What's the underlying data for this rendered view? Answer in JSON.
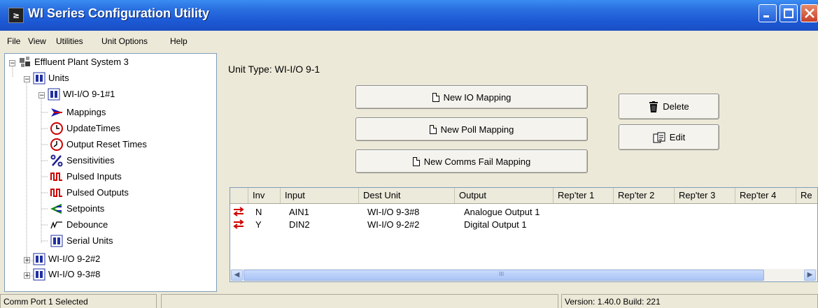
{
  "window": {
    "title": "WI Series Configuration Utility",
    "app_icon": "app-logo-icon"
  },
  "menu": [
    "File",
    "View",
    "Utilities",
    "Unit Options",
    "Help"
  ],
  "tree": {
    "root": "Effluent Plant System 3",
    "units": "Units",
    "unit1": "WI-I/O 9-1#1",
    "children": [
      "Mappings",
      "UpdateTimes",
      "Output Reset Times",
      "Sensitivities",
      "Pulsed Inputs",
      "Pulsed Outputs",
      "Setpoints",
      "Debounce",
      "Serial Units"
    ],
    "unit2": "WI-I/O 9-2#2",
    "unit3": "WI-I/O 9-3#8"
  },
  "panel": {
    "unit_type": "Unit Type:  WI-I/O 9-1",
    "buttons": {
      "new_io": "New IO Mapping",
      "new_poll": "New Poll Mapping",
      "new_comms": "New Comms Fail Mapping",
      "delete": "Delete",
      "edit": "Edit"
    }
  },
  "grid": {
    "headers": [
      "",
      "Inv",
      "Input",
      "Dest Unit",
      "Output",
      "Rep'ter 1",
      "Rep'ter 2",
      "Rep'ter 3",
      "Rep'ter 4",
      "Re"
    ],
    "rows": [
      {
        "inv": "N",
        "input": "AIN1",
        "dest": "WI-I/O 9-3#8",
        "output": "Analogue Output 1"
      },
      {
        "inv": "Y",
        "input": "DIN2",
        "dest": "WI-I/O 9-2#2",
        "output": "Digital Output 1"
      }
    ],
    "scroll_center": "III"
  },
  "status": {
    "left": "Comm Port 1 Selected",
    "middle": "",
    "right": "Version: 1.40.0 Build: 221"
  },
  "colors": {
    "title_bar": "#1c58d4",
    "arrow_red": "#d00000",
    "tree_icon_blue": "#2030a0"
  }
}
